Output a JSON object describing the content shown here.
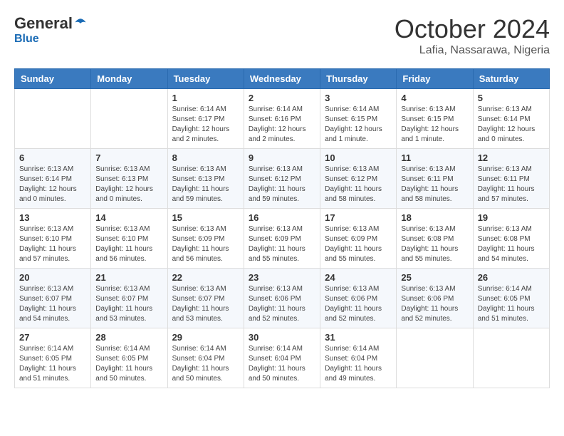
{
  "header": {
    "logo_general": "General",
    "logo_blue": "Blue",
    "month_year": "October 2024",
    "location": "Lafia, Nassarawa, Nigeria"
  },
  "weekdays": [
    "Sunday",
    "Monday",
    "Tuesday",
    "Wednesday",
    "Thursday",
    "Friday",
    "Saturday"
  ],
  "weeks": [
    [
      {
        "day": "",
        "info": ""
      },
      {
        "day": "",
        "info": ""
      },
      {
        "day": "1",
        "info": "Sunrise: 6:14 AM\nSunset: 6:17 PM\nDaylight: 12 hours and 2 minutes."
      },
      {
        "day": "2",
        "info": "Sunrise: 6:14 AM\nSunset: 6:16 PM\nDaylight: 12 hours and 2 minutes."
      },
      {
        "day": "3",
        "info": "Sunrise: 6:14 AM\nSunset: 6:15 PM\nDaylight: 12 hours and 1 minute."
      },
      {
        "day": "4",
        "info": "Sunrise: 6:13 AM\nSunset: 6:15 PM\nDaylight: 12 hours and 1 minute."
      },
      {
        "day": "5",
        "info": "Sunrise: 6:13 AM\nSunset: 6:14 PM\nDaylight: 12 hours and 0 minutes."
      }
    ],
    [
      {
        "day": "6",
        "info": "Sunrise: 6:13 AM\nSunset: 6:14 PM\nDaylight: 12 hours and 0 minutes."
      },
      {
        "day": "7",
        "info": "Sunrise: 6:13 AM\nSunset: 6:13 PM\nDaylight: 12 hours and 0 minutes."
      },
      {
        "day": "8",
        "info": "Sunrise: 6:13 AM\nSunset: 6:13 PM\nDaylight: 11 hours and 59 minutes."
      },
      {
        "day": "9",
        "info": "Sunrise: 6:13 AM\nSunset: 6:12 PM\nDaylight: 11 hours and 59 minutes."
      },
      {
        "day": "10",
        "info": "Sunrise: 6:13 AM\nSunset: 6:12 PM\nDaylight: 11 hours and 58 minutes."
      },
      {
        "day": "11",
        "info": "Sunrise: 6:13 AM\nSunset: 6:11 PM\nDaylight: 11 hours and 58 minutes."
      },
      {
        "day": "12",
        "info": "Sunrise: 6:13 AM\nSunset: 6:11 PM\nDaylight: 11 hours and 57 minutes."
      }
    ],
    [
      {
        "day": "13",
        "info": "Sunrise: 6:13 AM\nSunset: 6:10 PM\nDaylight: 11 hours and 57 minutes."
      },
      {
        "day": "14",
        "info": "Sunrise: 6:13 AM\nSunset: 6:10 PM\nDaylight: 11 hours and 56 minutes."
      },
      {
        "day": "15",
        "info": "Sunrise: 6:13 AM\nSunset: 6:09 PM\nDaylight: 11 hours and 56 minutes."
      },
      {
        "day": "16",
        "info": "Sunrise: 6:13 AM\nSunset: 6:09 PM\nDaylight: 11 hours and 55 minutes."
      },
      {
        "day": "17",
        "info": "Sunrise: 6:13 AM\nSunset: 6:09 PM\nDaylight: 11 hours and 55 minutes."
      },
      {
        "day": "18",
        "info": "Sunrise: 6:13 AM\nSunset: 6:08 PM\nDaylight: 11 hours and 55 minutes."
      },
      {
        "day": "19",
        "info": "Sunrise: 6:13 AM\nSunset: 6:08 PM\nDaylight: 11 hours and 54 minutes."
      }
    ],
    [
      {
        "day": "20",
        "info": "Sunrise: 6:13 AM\nSunset: 6:07 PM\nDaylight: 11 hours and 54 minutes."
      },
      {
        "day": "21",
        "info": "Sunrise: 6:13 AM\nSunset: 6:07 PM\nDaylight: 11 hours and 53 minutes."
      },
      {
        "day": "22",
        "info": "Sunrise: 6:13 AM\nSunset: 6:07 PM\nDaylight: 11 hours and 53 minutes."
      },
      {
        "day": "23",
        "info": "Sunrise: 6:13 AM\nSunset: 6:06 PM\nDaylight: 11 hours and 52 minutes."
      },
      {
        "day": "24",
        "info": "Sunrise: 6:13 AM\nSunset: 6:06 PM\nDaylight: 11 hours and 52 minutes."
      },
      {
        "day": "25",
        "info": "Sunrise: 6:13 AM\nSunset: 6:06 PM\nDaylight: 11 hours and 52 minutes."
      },
      {
        "day": "26",
        "info": "Sunrise: 6:14 AM\nSunset: 6:05 PM\nDaylight: 11 hours and 51 minutes."
      }
    ],
    [
      {
        "day": "27",
        "info": "Sunrise: 6:14 AM\nSunset: 6:05 PM\nDaylight: 11 hours and 51 minutes."
      },
      {
        "day": "28",
        "info": "Sunrise: 6:14 AM\nSunset: 6:05 PM\nDaylight: 11 hours and 50 minutes."
      },
      {
        "day": "29",
        "info": "Sunrise: 6:14 AM\nSunset: 6:04 PM\nDaylight: 11 hours and 50 minutes."
      },
      {
        "day": "30",
        "info": "Sunrise: 6:14 AM\nSunset: 6:04 PM\nDaylight: 11 hours and 50 minutes."
      },
      {
        "day": "31",
        "info": "Sunrise: 6:14 AM\nSunset: 6:04 PM\nDaylight: 11 hours and 49 minutes."
      },
      {
        "day": "",
        "info": ""
      },
      {
        "day": "",
        "info": ""
      }
    ]
  ]
}
